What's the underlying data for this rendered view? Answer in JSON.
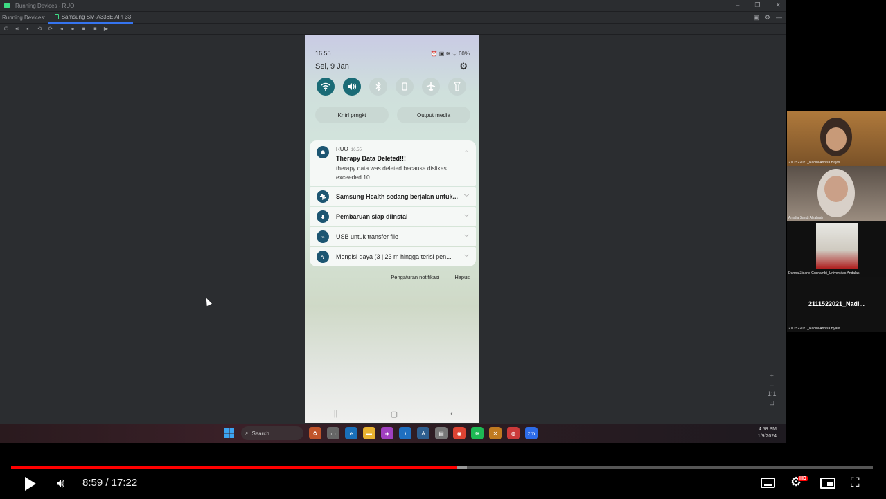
{
  "ide": {
    "window_title": "Running Devices - RUO",
    "tab_running_devices": "Running Devices:",
    "tab_device": "Samsung SM-A336E API 33",
    "zoom_ratio": "1:1"
  },
  "phone": {
    "time": "16.55",
    "status_icons": "⏰ ▣ ≋ ᯤ 60%",
    "date": "Sel, 9 Jan",
    "quick_settings": [
      {
        "icon": "wifi-icon",
        "state": "on"
      },
      {
        "icon": "sound-icon",
        "state": "on"
      },
      {
        "icon": "bluetooth-icon",
        "state": "off"
      },
      {
        "icon": "rotate-icon",
        "state": "off"
      },
      {
        "icon": "airplane-icon",
        "state": "off"
      },
      {
        "icon": "flashlight-icon",
        "state": "off"
      }
    ],
    "device_control_label": "Kntrl prngkt",
    "media_output_label": "Output media",
    "notification_main": {
      "app": "RUO",
      "time": "16.55",
      "title": "Therapy Data Deleted!!!",
      "body": "therapy data was deleted because dislikes exceeded 10"
    },
    "notifications": [
      {
        "text": "Samsung Health sedang berjalan untuk...",
        "bold": true
      },
      {
        "text": "Pembaruan siap diinstal",
        "bold": true
      },
      {
        "text": "USB untuk transfer file",
        "bold": false
      },
      {
        "text": "Mengisi daya (3 j 23 m hingga terisi pen...",
        "bold": false
      }
    ],
    "notification_settings_label": "Pengaturan notifikasi",
    "clear_label": "Hapus"
  },
  "taskbar": {
    "search_placeholder": "Search",
    "clock_time": "4:58 PM",
    "clock_date": "1/9/2024"
  },
  "participants": [
    {
      "name": "2111522021_Nadini Annisa Bayiti"
    },
    {
      "name": "Amalia Sandi Alzahrah"
    },
    {
      "name": "Darma Zidane Gusnambi_Universitas Andalas"
    },
    {
      "name": "2111522021_Nadini Annisa Byant",
      "big_label": "2111522021_Nadi..."
    }
  ],
  "player": {
    "time_display": "8:59 / 17:22",
    "progress": 0.518,
    "buffered": 0.529,
    "quality_badge": "HD",
    "accent": "#ff0000"
  }
}
